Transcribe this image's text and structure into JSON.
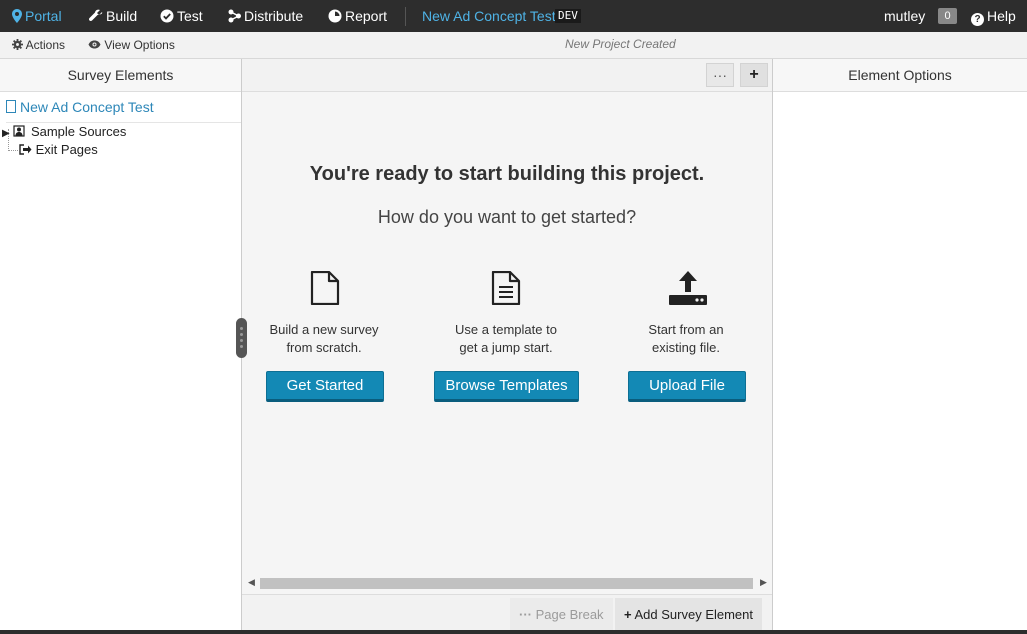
{
  "nav": {
    "portal": "Portal",
    "build": "Build",
    "test": "Test",
    "distribute": "Distribute",
    "report": "Report",
    "project_title": "New Ad Concept Test",
    "env_badge": "DEV",
    "user": "mutley",
    "notification_count": "0",
    "help": "Help"
  },
  "toolbar": {
    "actions": "Actions",
    "view_options": "View Options",
    "status": "New Project Created"
  },
  "left_panel": {
    "header": "Survey Elements",
    "root": "New Ad Concept Test",
    "items": [
      {
        "label": "Sample Sources"
      },
      {
        "label": "Exit Pages"
      }
    ]
  },
  "center": {
    "more_button": "···",
    "add_button": "+",
    "title": "You're ready to start building this project.",
    "subtitle": "How do you want to get started?",
    "options": [
      {
        "icon": "blank-document-icon",
        "line1": "Build a new survey",
        "line2": "from scratch.",
        "button": "Get Started"
      },
      {
        "icon": "template-document-icon",
        "line1": "Use a template to",
        "line2": "get a jump start.",
        "button": "Browse Templates"
      },
      {
        "icon": "upload-icon",
        "line1": "Start from an",
        "line2": "existing file.",
        "button": "Upload File"
      }
    ],
    "page_break": "Page Break",
    "add_survey_element": "Add Survey Element"
  },
  "right_panel": {
    "header": "Element Options"
  },
  "colors": {
    "nav_bg": "#2d2d2d",
    "accent": "#4fb3e6",
    "cta": "#1389b5"
  }
}
